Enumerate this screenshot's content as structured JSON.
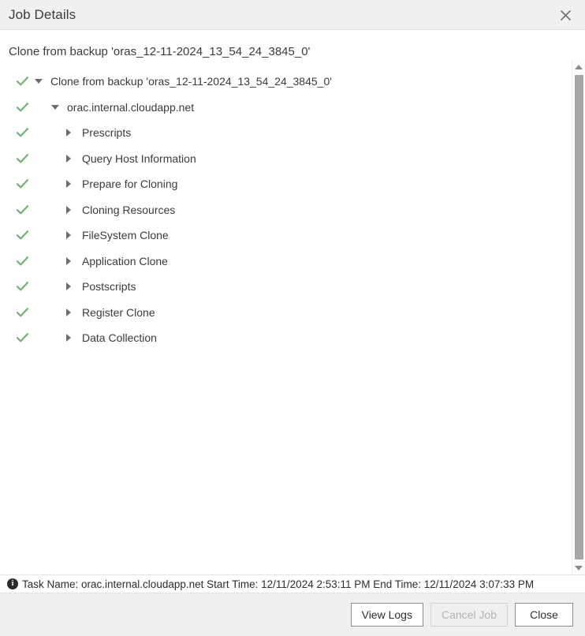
{
  "window": {
    "title": "Job Details",
    "close_icon": "close-icon"
  },
  "content": {
    "subtitle": "Clone from backup 'oras_12-11-2024_13_54_24_3845_0'",
    "tree": [
      {
        "label": "Clone from backup 'oras_12-11-2024_13_54_24_3845_0'",
        "level": 0,
        "expanded": true,
        "status": "success"
      },
      {
        "label": "orac.internal.cloudapp.net",
        "level": 1,
        "expanded": true,
        "status": "success"
      },
      {
        "label": "Prescripts",
        "level": 2,
        "expanded": false,
        "status": "success"
      },
      {
        "label": "Query Host Information",
        "level": 2,
        "expanded": false,
        "status": "success"
      },
      {
        "label": "Prepare for Cloning",
        "level": 2,
        "expanded": false,
        "status": "success"
      },
      {
        "label": "Cloning Resources",
        "level": 2,
        "expanded": false,
        "status": "success"
      },
      {
        "label": "FileSystem Clone",
        "level": 2,
        "expanded": false,
        "status": "success"
      },
      {
        "label": "Application Clone",
        "level": 2,
        "expanded": false,
        "status": "success"
      },
      {
        "label": "Postscripts",
        "level": 2,
        "expanded": false,
        "status": "success"
      },
      {
        "label": "Register Clone",
        "level": 2,
        "expanded": false,
        "status": "success"
      },
      {
        "label": "Data Collection",
        "level": 2,
        "expanded": false,
        "status": "success"
      }
    ]
  },
  "statusbar": {
    "icon": "info-icon",
    "text": "Task Name: orac.internal.cloudapp.net Start Time: 12/11/2024 2:53:11 PM End Time: 12/11/2024 3:07:33 PM"
  },
  "footer": {
    "view_logs_label": "View Logs",
    "cancel_job_label": "Cancel Job",
    "close_label": "Close"
  },
  "scrollbar": {
    "up_icon": "scroll-up-arrow-icon",
    "down_icon": "scroll-down-arrow-icon"
  },
  "colors": {
    "success_check": "#6bb86b",
    "header_bg": "#f0f0f0",
    "text": "#3b3b3b",
    "twisty": "#6d6d6d"
  }
}
